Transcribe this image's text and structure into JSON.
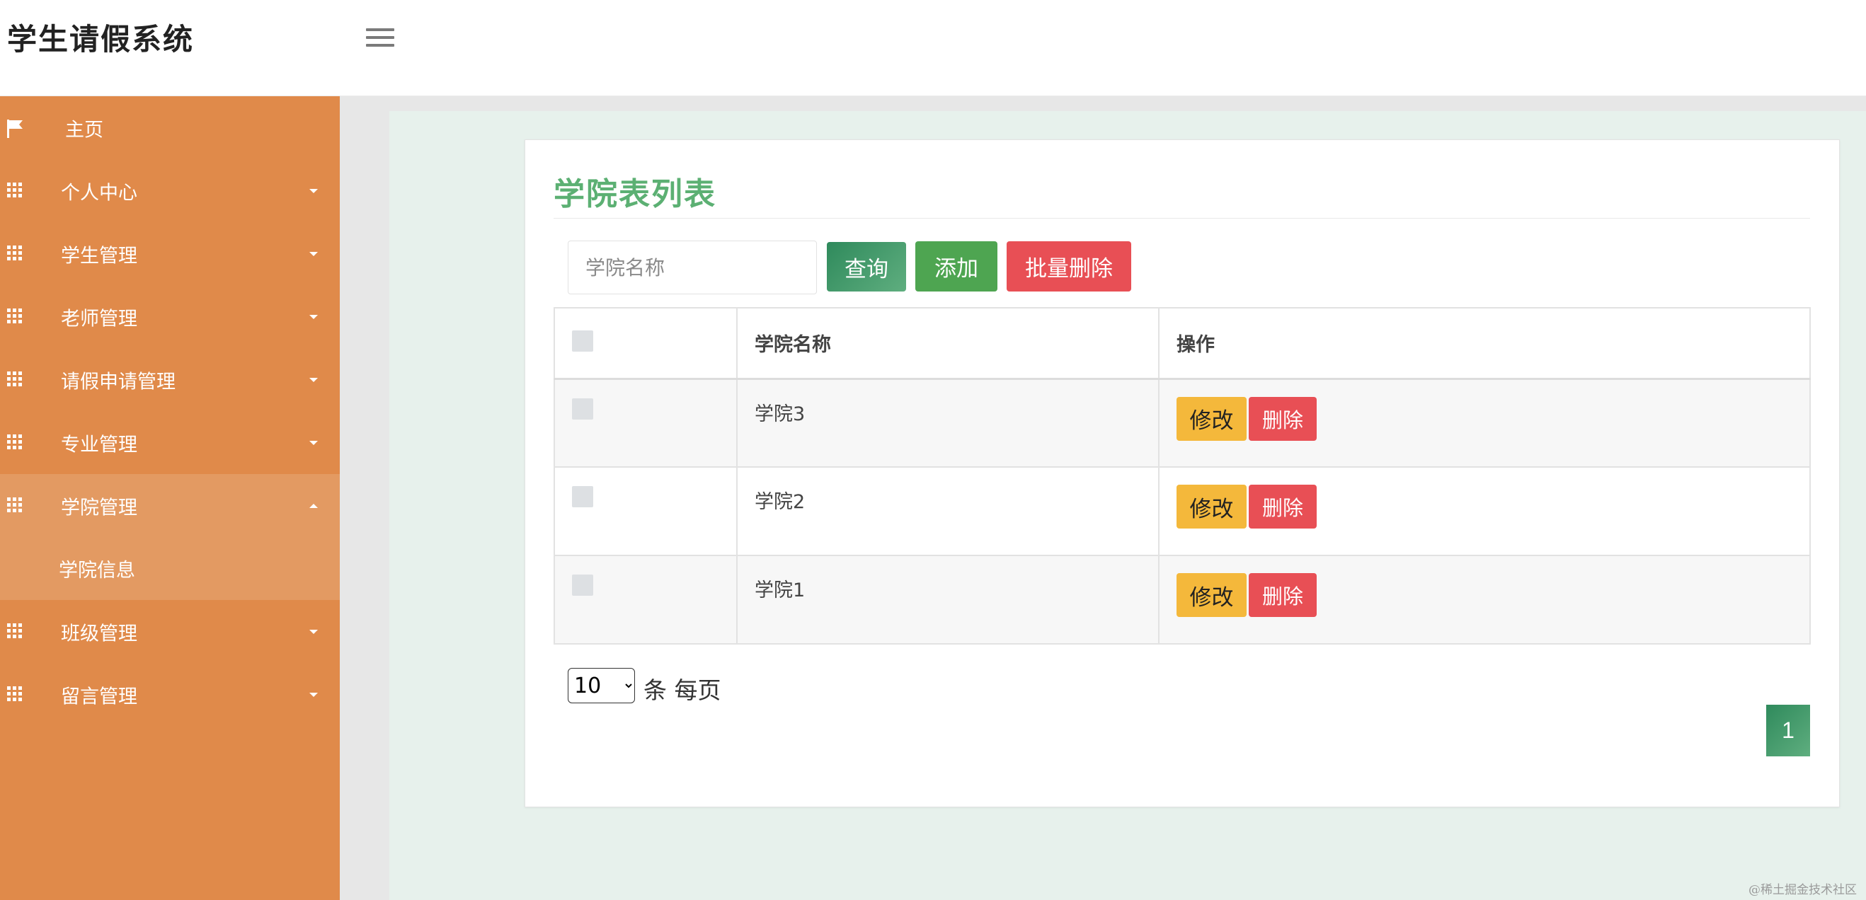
{
  "header": {
    "app_title": "学生请假系统"
  },
  "sidebar": {
    "items": [
      {
        "label": "主页",
        "icon": "flag-icon"
      },
      {
        "label": "个人中心",
        "icon": "grid-icon"
      },
      {
        "label": "学生管理",
        "icon": "grid-icon"
      },
      {
        "label": "老师管理",
        "icon": "grid-icon"
      },
      {
        "label": "请假申请管理",
        "icon": "grid-icon"
      },
      {
        "label": "专业管理",
        "icon": "grid-icon"
      },
      {
        "label": "学院管理",
        "icon": "grid-icon",
        "expanded": true,
        "children": [
          {
            "label": "学院信息"
          }
        ]
      },
      {
        "label": "班级管理",
        "icon": "grid-icon"
      },
      {
        "label": "留言管理",
        "icon": "grid-icon"
      }
    ],
    "color": "#e08a4a"
  },
  "main": {
    "title": "学院表列表",
    "search": {
      "placeholder": "学院名称",
      "value": ""
    },
    "buttons": {
      "query": "查询",
      "add": "添加",
      "bulk_delete": "批量删除"
    },
    "table": {
      "headers": [
        "",
        "学院名称",
        "操作"
      ],
      "rows": [
        {
          "name": "学院3"
        },
        {
          "name": "学院2"
        },
        {
          "name": "学院1"
        }
      ],
      "edit_label": "修改",
      "delete_label": "删除"
    },
    "pagination": {
      "page_size": "10",
      "page_size_label": "条 每页",
      "current_page": "1"
    }
  },
  "watermark": "@稀土掘金技术社区",
  "colors": {
    "accent_green": "#5cb073",
    "add_green": "#4ea551",
    "danger_red": "#e84f55",
    "warning_yellow": "#f4b83b"
  }
}
